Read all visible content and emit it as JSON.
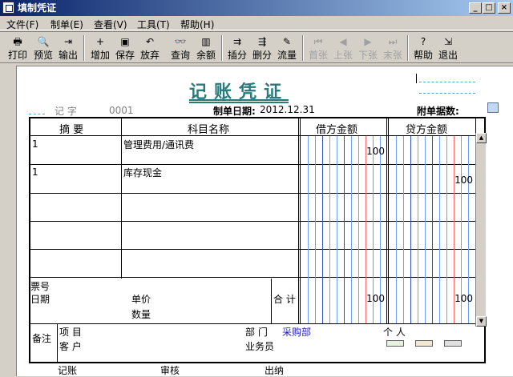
{
  "window": {
    "title": "填制凭证",
    "min": "_",
    "max": "□",
    "close": "×"
  },
  "menu": [
    "文件(F)",
    "制单(E)",
    "查看(V)",
    "工具(T)",
    "帮助(H)"
  ],
  "toolbar": [
    {
      "label": "打印",
      "icon": "print-icon",
      "glyph": "🖶",
      "enabled": true
    },
    {
      "label": "预览",
      "icon": "preview-icon",
      "glyph": "🔍",
      "enabled": true
    },
    {
      "label": "输出",
      "icon": "export-icon",
      "glyph": "⇥",
      "enabled": true
    },
    {
      "label": "增加",
      "icon": "add-icon",
      "glyph": "+",
      "enabled": true
    },
    {
      "label": "保存",
      "icon": "save-icon",
      "glyph": "▣",
      "enabled": true
    },
    {
      "label": "放弃",
      "icon": "undo-icon",
      "glyph": "↶",
      "enabled": true
    },
    {
      "label": "查询",
      "icon": "binoculars-icon",
      "glyph": "👓",
      "enabled": true
    },
    {
      "label": "余额",
      "icon": "bar-chart-icon",
      "glyph": "▥",
      "enabled": true
    },
    {
      "label": "插分",
      "icon": "insert-row-icon",
      "glyph": "⇉",
      "enabled": true
    },
    {
      "label": "删分",
      "icon": "delete-row-icon",
      "glyph": "⇶",
      "enabled": true
    },
    {
      "label": "流量",
      "icon": "flow-icon",
      "glyph": "✎",
      "enabled": true
    },
    {
      "label": "首张",
      "icon": "first-icon",
      "glyph": "⏮",
      "enabled": false
    },
    {
      "label": "上张",
      "icon": "prev-icon",
      "glyph": "◀",
      "enabled": false
    },
    {
      "label": "下张",
      "icon": "next-icon",
      "glyph": "▶",
      "enabled": false
    },
    {
      "label": "末张",
      "icon": "last-icon",
      "glyph": "⏭",
      "enabled": false
    },
    {
      "label": "帮助",
      "icon": "help-icon",
      "glyph": "?",
      "enabled": true
    },
    {
      "label": "退出",
      "icon": "exit-icon",
      "glyph": "⇲",
      "enabled": true
    }
  ],
  "voucher": {
    "title": "记账凭证",
    "type_label": "记    字",
    "number": "0001",
    "date_label": "制单日期:",
    "date": "2012.12.31",
    "attach_label": "附单据数:",
    "attach_value": "",
    "headers": {
      "summary": "摘  要",
      "account": "科目名称",
      "debit": "借方金额",
      "credit": "贷方金额"
    },
    "rows": [
      {
        "summary": "1",
        "account": "管理费用/通讯费",
        "debit": "100",
        "credit": ""
      },
      {
        "summary": "1",
        "account": "库存现金",
        "debit": "",
        "credit": "100"
      },
      {
        "summary": "",
        "account": "",
        "debit": "",
        "credit": ""
      },
      {
        "summary": "",
        "account": "",
        "debit": "",
        "credit": ""
      },
      {
        "summary": "",
        "account": "",
        "debit": "",
        "credit": ""
      }
    ],
    "bill_no_label": "票号",
    "date_field_label": "日期",
    "unit_price_label": "单价",
    "quantity_label": "数量",
    "total_label": "合 计",
    "total_debit": "100",
    "total_credit": "100",
    "remark_label": "备注",
    "project_label": "项  目",
    "customer_label": "客  户",
    "dept_label": "部  门",
    "dept_value": "采购部",
    "person_label": "个  人",
    "salesman_label": "业务员",
    "bookkeeper_label": "记账",
    "auditor_label": "审核",
    "cashier_label": "出纳"
  }
}
